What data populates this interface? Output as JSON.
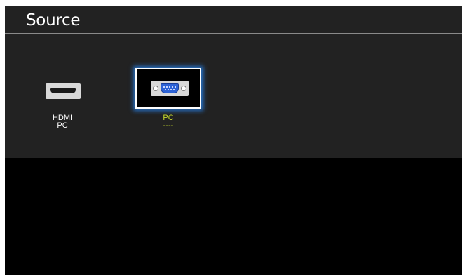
{
  "screen": {
    "title": "Source"
  },
  "sources": [
    {
      "id": "hdmi",
      "icon": "hdmi-port-icon",
      "line1": "HDMI",
      "line2": "PC",
      "selected": false
    },
    {
      "id": "pc",
      "icon": "vga-port-icon",
      "line1": "PC",
      "line2": "----",
      "selected": true
    }
  ],
  "colors": {
    "panel": "#222222",
    "background": "#000000",
    "selected_text": "#c8dc2c",
    "focus_glow": "#288cff",
    "vga_blue": "#2d63d6"
  }
}
